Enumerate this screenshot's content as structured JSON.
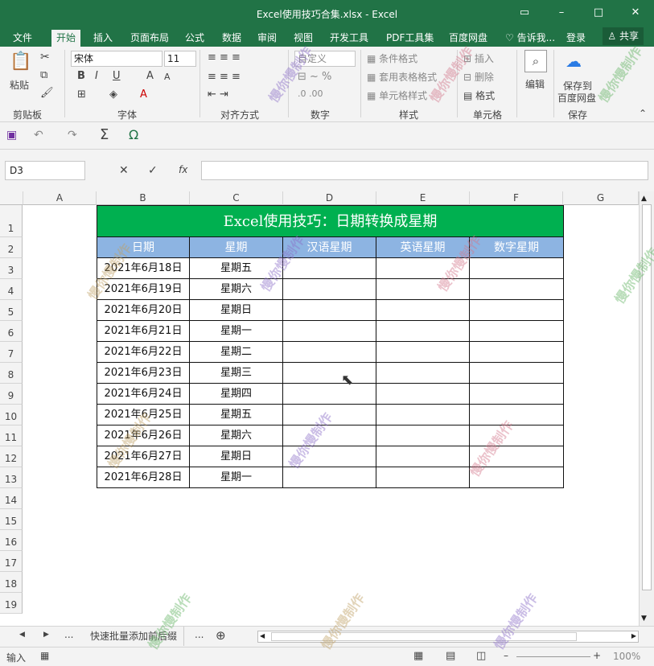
{
  "window": {
    "title": "Excel使用技巧合集.xlsx - Excel"
  },
  "tabs": [
    "文件",
    "开始",
    "插入",
    "页面布局",
    "公式",
    "数据",
    "审阅",
    "视图",
    "开发工具",
    "PDF工具集",
    "百度网盘",
    "告诉我...",
    "登录",
    "共享"
  ],
  "ribbon": {
    "font_name": "宋体",
    "font_size": "11",
    "number_format": "自定义",
    "paste": "粘贴",
    "cond_format": "条件格式",
    "table_format": "套用表格格式",
    "cell_style": "单元格样式",
    "insert": "插入",
    "delete": "删除",
    "format": "格式",
    "edit": "编辑",
    "save_to": "保存到",
    "baidu": "百度网盘",
    "groups": [
      "剪贴板",
      "字体",
      "对齐方式",
      "数字",
      "样式",
      "单元格",
      "保存"
    ]
  },
  "formula_bar": {
    "name_box": "D3",
    "fx": "fx",
    "value": ""
  },
  "columns": [
    "A",
    "B",
    "C",
    "D",
    "E",
    "F",
    "G"
  ],
  "rows": [
    "1",
    "2",
    "3",
    "4",
    "5",
    "6",
    "7",
    "8",
    "9",
    "10",
    "11",
    "12",
    "13",
    "14",
    "15",
    "16",
    "17",
    "18",
    "19"
  ],
  "sheet": {
    "title": "Excel使用技巧：日期转换成星期",
    "headers": [
      "日期",
      "星期",
      "汉语星期",
      "英语星期",
      "数字星期"
    ],
    "data": [
      [
        "2021年6月18日",
        "星期五"
      ],
      [
        "2021年6月19日",
        "星期六"
      ],
      [
        "2021年6月20日",
        "星期日"
      ],
      [
        "2021年6月21日",
        "星期一"
      ],
      [
        "2021年6月22日",
        "星期二"
      ],
      [
        "2021年6月23日",
        "星期三"
      ],
      [
        "2021年6月24日",
        "星期四"
      ],
      [
        "2021年6月25日",
        "星期五"
      ],
      [
        "2021年6月26日",
        "星期六"
      ],
      [
        "2021年6月27日",
        "星期日"
      ],
      [
        "2021年6月28日",
        "星期一"
      ]
    ]
  },
  "sheet_tab": "快速批量添加前后缀",
  "status": {
    "mode": "输入",
    "zoom": "100%"
  },
  "watermark": "慢你慢制作",
  "colors": {
    "accent": "#217346",
    "title_fill": "#00b050",
    "header_fill": "#8db4e2"
  }
}
